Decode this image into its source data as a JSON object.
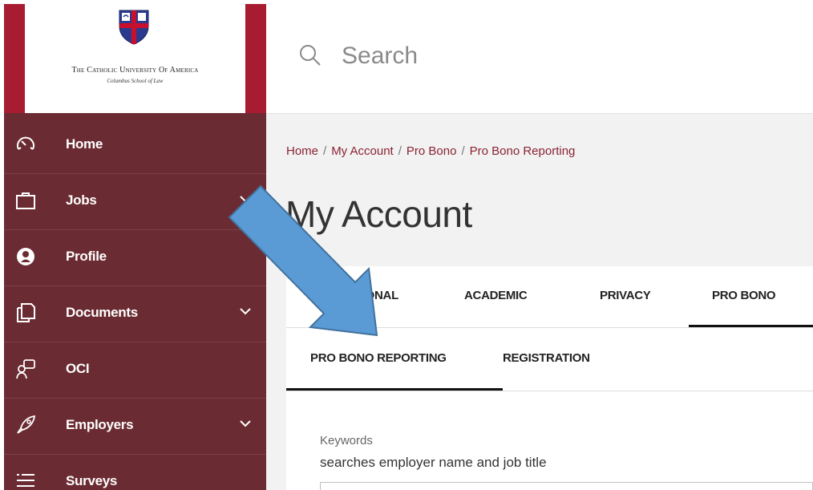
{
  "logo": {
    "title": "The Catholic University Of America",
    "subtitle": "Columbus School of Law"
  },
  "search": {
    "placeholder": "Search"
  },
  "sidebar": {
    "items": [
      {
        "label": "Home",
        "icon": "speedometer-icon",
        "has_chevron": false
      },
      {
        "label": "Jobs",
        "icon": "briefcase-icon",
        "has_chevron": true
      },
      {
        "label": "Profile",
        "icon": "person-icon",
        "has_chevron": false
      },
      {
        "label": "Documents",
        "icon": "documents-icon",
        "has_chevron": true
      },
      {
        "label": "OCI",
        "icon": "interview-icon",
        "has_chevron": false
      },
      {
        "label": "Employers",
        "icon": "rocket-icon",
        "has_chevron": true
      },
      {
        "label": "Surveys",
        "icon": "list-icon",
        "has_chevron": false
      }
    ]
  },
  "breadcrumb": {
    "items": [
      "Home",
      "My Account",
      "Pro Bono",
      "Pro Bono Reporting"
    ],
    "separator": "/"
  },
  "page_title": "My Account",
  "tabs": {
    "primary": [
      {
        "label": "PERSONAL",
        "active": false
      },
      {
        "label": "ACADEMIC",
        "active": false
      },
      {
        "label": "PRIVACY",
        "active": false
      },
      {
        "label": "PRO BONO",
        "active": true
      }
    ],
    "secondary": [
      {
        "label": "PRO BONO REPORTING",
        "active": true
      },
      {
        "label": "REGISTRATION",
        "active": false
      }
    ]
  },
  "form": {
    "keywords_label": "Keywords",
    "keywords_help": "searches employer name and job title"
  },
  "colors": {
    "sidebar_bg": "#6b2b32",
    "logo_accent": "#a81c31",
    "link": "#8a2232",
    "annotation_arrow": "#5b9bd5"
  }
}
